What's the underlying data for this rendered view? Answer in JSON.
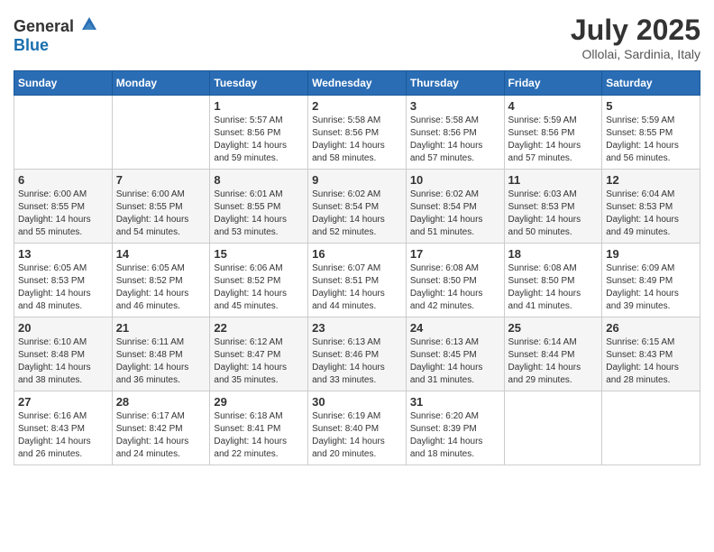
{
  "header": {
    "logo_general": "General",
    "logo_blue": "Blue",
    "month_title": "July 2025",
    "location": "Ollolai, Sardinia, Italy"
  },
  "days_of_week": [
    "Sunday",
    "Monday",
    "Tuesday",
    "Wednesday",
    "Thursday",
    "Friday",
    "Saturday"
  ],
  "weeks": [
    [
      {
        "day": "",
        "sunrise": "",
        "sunset": "",
        "daylight": ""
      },
      {
        "day": "",
        "sunrise": "",
        "sunset": "",
        "daylight": ""
      },
      {
        "day": "1",
        "sunrise": "Sunrise: 5:57 AM",
        "sunset": "Sunset: 8:56 PM",
        "daylight": "Daylight: 14 hours and 59 minutes."
      },
      {
        "day": "2",
        "sunrise": "Sunrise: 5:58 AM",
        "sunset": "Sunset: 8:56 PM",
        "daylight": "Daylight: 14 hours and 58 minutes."
      },
      {
        "day": "3",
        "sunrise": "Sunrise: 5:58 AM",
        "sunset": "Sunset: 8:56 PM",
        "daylight": "Daylight: 14 hours and 57 minutes."
      },
      {
        "day": "4",
        "sunrise": "Sunrise: 5:59 AM",
        "sunset": "Sunset: 8:56 PM",
        "daylight": "Daylight: 14 hours and 57 minutes."
      },
      {
        "day": "5",
        "sunrise": "Sunrise: 5:59 AM",
        "sunset": "Sunset: 8:55 PM",
        "daylight": "Daylight: 14 hours and 56 minutes."
      }
    ],
    [
      {
        "day": "6",
        "sunrise": "Sunrise: 6:00 AM",
        "sunset": "Sunset: 8:55 PM",
        "daylight": "Daylight: 14 hours and 55 minutes."
      },
      {
        "day": "7",
        "sunrise": "Sunrise: 6:00 AM",
        "sunset": "Sunset: 8:55 PM",
        "daylight": "Daylight: 14 hours and 54 minutes."
      },
      {
        "day": "8",
        "sunrise": "Sunrise: 6:01 AM",
        "sunset": "Sunset: 8:55 PM",
        "daylight": "Daylight: 14 hours and 53 minutes."
      },
      {
        "day": "9",
        "sunrise": "Sunrise: 6:02 AM",
        "sunset": "Sunset: 8:54 PM",
        "daylight": "Daylight: 14 hours and 52 minutes."
      },
      {
        "day": "10",
        "sunrise": "Sunrise: 6:02 AM",
        "sunset": "Sunset: 8:54 PM",
        "daylight": "Daylight: 14 hours and 51 minutes."
      },
      {
        "day": "11",
        "sunrise": "Sunrise: 6:03 AM",
        "sunset": "Sunset: 8:53 PM",
        "daylight": "Daylight: 14 hours and 50 minutes."
      },
      {
        "day": "12",
        "sunrise": "Sunrise: 6:04 AM",
        "sunset": "Sunset: 8:53 PM",
        "daylight": "Daylight: 14 hours and 49 minutes."
      }
    ],
    [
      {
        "day": "13",
        "sunrise": "Sunrise: 6:05 AM",
        "sunset": "Sunset: 8:53 PM",
        "daylight": "Daylight: 14 hours and 48 minutes."
      },
      {
        "day": "14",
        "sunrise": "Sunrise: 6:05 AM",
        "sunset": "Sunset: 8:52 PM",
        "daylight": "Daylight: 14 hours and 46 minutes."
      },
      {
        "day": "15",
        "sunrise": "Sunrise: 6:06 AM",
        "sunset": "Sunset: 8:52 PM",
        "daylight": "Daylight: 14 hours and 45 minutes."
      },
      {
        "day": "16",
        "sunrise": "Sunrise: 6:07 AM",
        "sunset": "Sunset: 8:51 PM",
        "daylight": "Daylight: 14 hours and 44 minutes."
      },
      {
        "day": "17",
        "sunrise": "Sunrise: 6:08 AM",
        "sunset": "Sunset: 8:50 PM",
        "daylight": "Daylight: 14 hours and 42 minutes."
      },
      {
        "day": "18",
        "sunrise": "Sunrise: 6:08 AM",
        "sunset": "Sunset: 8:50 PM",
        "daylight": "Daylight: 14 hours and 41 minutes."
      },
      {
        "day": "19",
        "sunrise": "Sunrise: 6:09 AM",
        "sunset": "Sunset: 8:49 PM",
        "daylight": "Daylight: 14 hours and 39 minutes."
      }
    ],
    [
      {
        "day": "20",
        "sunrise": "Sunrise: 6:10 AM",
        "sunset": "Sunset: 8:48 PM",
        "daylight": "Daylight: 14 hours and 38 minutes."
      },
      {
        "day": "21",
        "sunrise": "Sunrise: 6:11 AM",
        "sunset": "Sunset: 8:48 PM",
        "daylight": "Daylight: 14 hours and 36 minutes."
      },
      {
        "day": "22",
        "sunrise": "Sunrise: 6:12 AM",
        "sunset": "Sunset: 8:47 PM",
        "daylight": "Daylight: 14 hours and 35 minutes."
      },
      {
        "day": "23",
        "sunrise": "Sunrise: 6:13 AM",
        "sunset": "Sunset: 8:46 PM",
        "daylight": "Daylight: 14 hours and 33 minutes."
      },
      {
        "day": "24",
        "sunrise": "Sunrise: 6:13 AM",
        "sunset": "Sunset: 8:45 PM",
        "daylight": "Daylight: 14 hours and 31 minutes."
      },
      {
        "day": "25",
        "sunrise": "Sunrise: 6:14 AM",
        "sunset": "Sunset: 8:44 PM",
        "daylight": "Daylight: 14 hours and 29 minutes."
      },
      {
        "day": "26",
        "sunrise": "Sunrise: 6:15 AM",
        "sunset": "Sunset: 8:43 PM",
        "daylight": "Daylight: 14 hours and 28 minutes."
      }
    ],
    [
      {
        "day": "27",
        "sunrise": "Sunrise: 6:16 AM",
        "sunset": "Sunset: 8:43 PM",
        "daylight": "Daylight: 14 hours and 26 minutes."
      },
      {
        "day": "28",
        "sunrise": "Sunrise: 6:17 AM",
        "sunset": "Sunset: 8:42 PM",
        "daylight": "Daylight: 14 hours and 24 minutes."
      },
      {
        "day": "29",
        "sunrise": "Sunrise: 6:18 AM",
        "sunset": "Sunset: 8:41 PM",
        "daylight": "Daylight: 14 hours and 22 minutes."
      },
      {
        "day": "30",
        "sunrise": "Sunrise: 6:19 AM",
        "sunset": "Sunset: 8:40 PM",
        "daylight": "Daylight: 14 hours and 20 minutes."
      },
      {
        "day": "31",
        "sunrise": "Sunrise: 6:20 AM",
        "sunset": "Sunset: 8:39 PM",
        "daylight": "Daylight: 14 hours and 18 minutes."
      },
      {
        "day": "",
        "sunrise": "",
        "sunset": "",
        "daylight": ""
      },
      {
        "day": "",
        "sunrise": "",
        "sunset": "",
        "daylight": ""
      }
    ]
  ]
}
